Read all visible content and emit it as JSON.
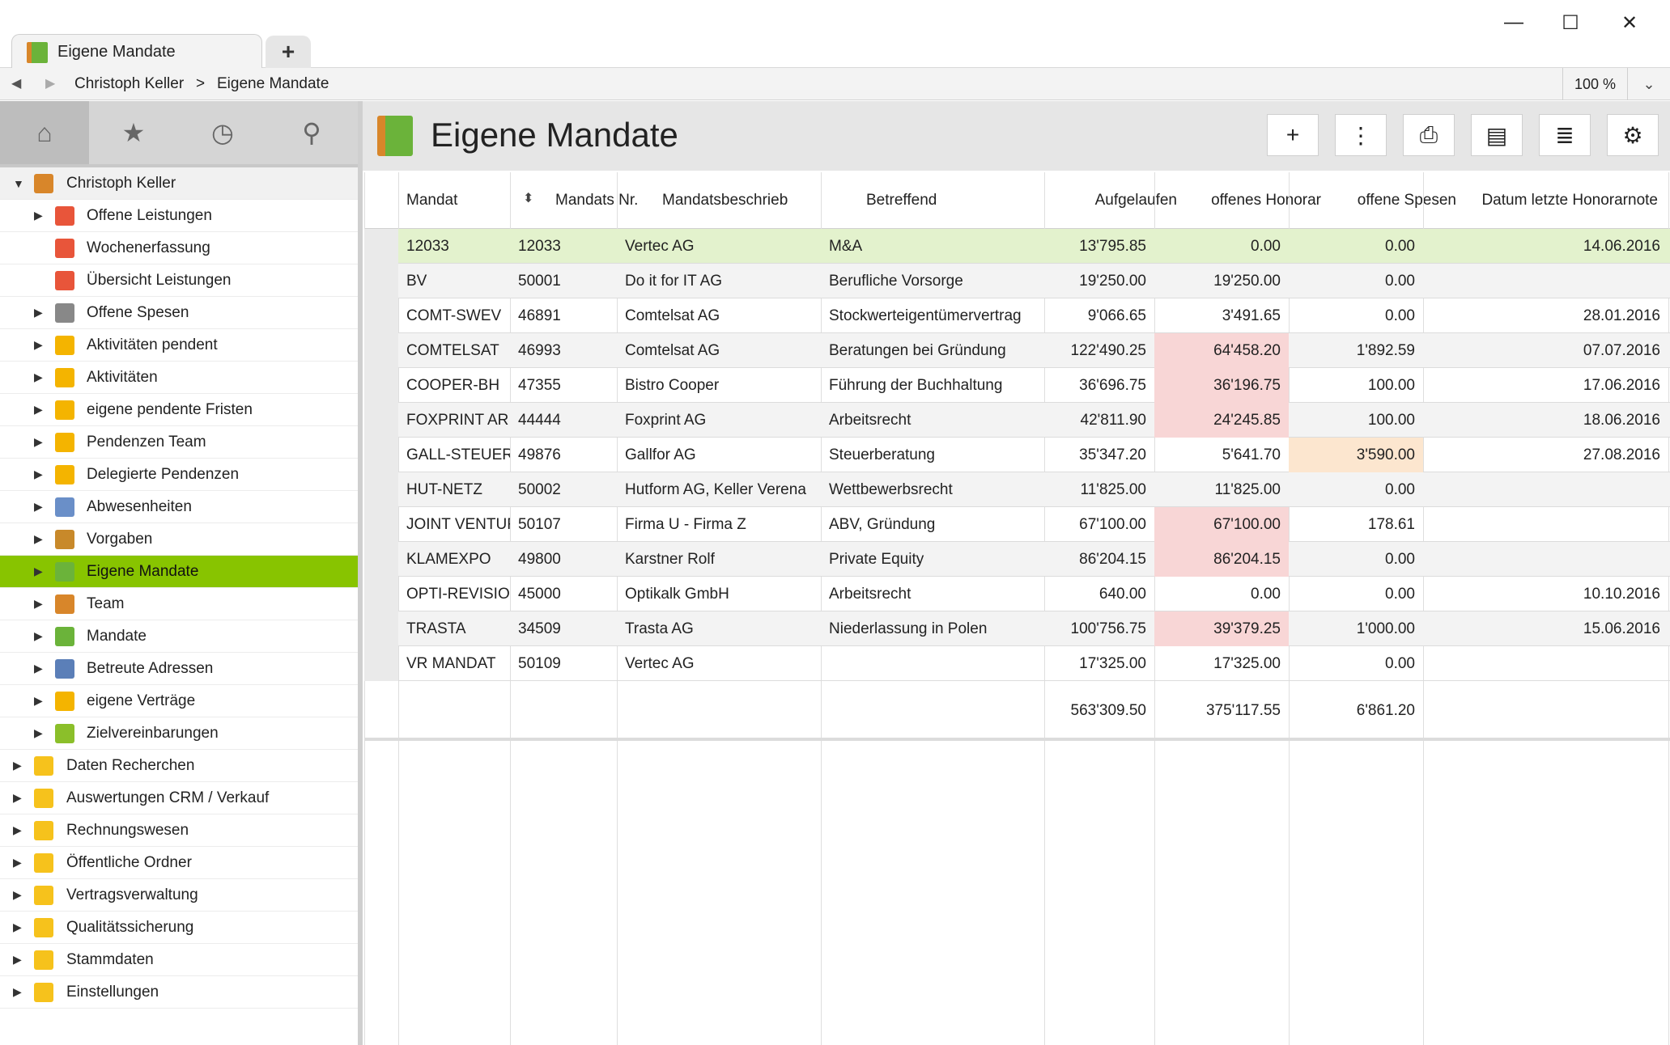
{
  "window": {
    "tab_title": "Eigene Mandate",
    "new_tab": "+",
    "minimize": "—",
    "maximize": "☐",
    "close": "✕"
  },
  "addressbar": {
    "back": "◀",
    "forward": "▶",
    "crumb_user": "Christoph Keller",
    "separator": ">",
    "crumb_page": "Eigene Mandate",
    "zoom": "100 %",
    "zoom_dropdown": "⌄"
  },
  "sidebar": {
    "tabs": [
      {
        "name": "home-icon",
        "glyph": "⌂"
      },
      {
        "name": "star-icon",
        "glyph": "★"
      },
      {
        "name": "clock-icon",
        "glyph": "◷"
      },
      {
        "name": "search-icon",
        "glyph": "⚲"
      }
    ],
    "root": "Christoph Keller",
    "items": [
      {
        "label": "Offene Leistungen",
        "icon": "clock-red-icon",
        "color": "#e8553a",
        "arrow": true
      },
      {
        "label": "Wochenerfassung",
        "icon": "calendar-clock-icon",
        "color": "#e8553a",
        "arrow": false
      },
      {
        "label": "Übersicht Leistungen",
        "icon": "target-icon",
        "color": "#e8553a",
        "arrow": false
      },
      {
        "label": "Offene Spesen",
        "icon": "receipt-icon",
        "color": "#888888",
        "arrow": true
      },
      {
        "label": "Aktivitäten pendent",
        "icon": "star-task-icon",
        "color": "#f4b400",
        "arrow": true
      },
      {
        "label": "Aktivitäten",
        "icon": "star-task-icon",
        "color": "#f4b400",
        "arrow": true
      },
      {
        "label": "eigene pendente Fristen",
        "icon": "star-task-icon",
        "color": "#f4b400",
        "arrow": true
      },
      {
        "label": "Pendenzen Team",
        "icon": "star-task-icon",
        "color": "#f4b400",
        "arrow": true
      },
      {
        "label": "Delegierte Pendenzen",
        "icon": "star-task-icon",
        "color": "#f4b400",
        "arrow": true
      },
      {
        "label": "Abwesenheiten",
        "icon": "person-absence-icon",
        "color": "#6a8fc8",
        "arrow": true
      },
      {
        "label": "Vorgaben",
        "icon": "person-target-icon",
        "color": "#c8892a",
        "arrow": true
      },
      {
        "label": "Eigene Mandate",
        "icon": "binder-icon",
        "color": "#6bb33a",
        "arrow": true,
        "selected": true
      },
      {
        "label": "Team",
        "icon": "person-icon",
        "color": "#d8862a",
        "arrow": true
      },
      {
        "label": "Mandate",
        "icon": "binder-icon",
        "color": "#6bb33a",
        "arrow": true
      },
      {
        "label": "Betreute Adressen",
        "icon": "building-icon",
        "color": "#5b7fb8",
        "arrow": true
      },
      {
        "label": "eigene Verträge",
        "icon": "contract-icon",
        "color": "#f4b400",
        "arrow": true
      },
      {
        "label": "Zielvereinbarungen",
        "icon": "flag-icon",
        "color": "#8bbf2a",
        "arrow": true
      }
    ],
    "folders": [
      {
        "label": "Daten Recherchen",
        "icon": "folder-icon"
      },
      {
        "label": "Auswertungen CRM / Verkauf",
        "icon": "folder-icon"
      },
      {
        "label": "Rechnungswesen",
        "icon": "folder-icon"
      },
      {
        "label": "Öffentliche Ordner",
        "icon": "folder-icon"
      },
      {
        "label": "Vertragsverwaltung",
        "icon": "folder-icon"
      },
      {
        "label": "Qualitätssicherung",
        "icon": "folder-icon"
      },
      {
        "label": "Stammdaten",
        "icon": "folder-icon"
      },
      {
        "label": "Einstellungen",
        "icon": "folder-settings-icon"
      }
    ]
  },
  "main": {
    "title": "Eigene Mandate",
    "toolbar": [
      {
        "name": "add-button",
        "glyph": "+"
      },
      {
        "name": "more-button",
        "glyph": "⋮"
      },
      {
        "name": "print-button",
        "glyph": "⎙"
      },
      {
        "name": "export-button",
        "glyph": "▤"
      },
      {
        "name": "list-settings-button",
        "glyph": "≣"
      },
      {
        "name": "settings-button",
        "glyph": "⚙"
      }
    ],
    "columns": [
      "Mandat",
      "Mandats Nr.",
      "Mandatsbeschrieb",
      "Betreffend",
      "Aufgelaufen",
      "offenes Honorar",
      "offene Spesen",
      "Datum letzte Honorarnote"
    ],
    "sort_glyph": "⬍",
    "rows": [
      {
        "mandat": "12033",
        "nr": "12033",
        "beschrieb": "Vertec AG",
        "betreffend": "M&A",
        "aufgelaufen": "13'795.85",
        "honorar": "0.00",
        "spesen": "0.00",
        "datum": "14.06.2016",
        "honorar_flag": "",
        "spesen_flag": ""
      },
      {
        "mandat": "BV",
        "nr": "50001",
        "beschrieb": "Do it for IT AG",
        "betreffend": "Berufliche Vorsorge",
        "aufgelaufen": "19'250.00",
        "honorar": "19'250.00",
        "spesen": "0.00",
        "datum": "",
        "honorar_flag": "",
        "spesen_flag": ""
      },
      {
        "mandat": "COMT-SWEV",
        "nr": "46891",
        "beschrieb": "Comtelsat AG",
        "betreffend": "Stockwerteigentümervertrag",
        "aufgelaufen": "9'066.65",
        "honorar": "3'491.65",
        "spesen": "0.00",
        "datum": "28.01.2016",
        "honorar_flag": "",
        "spesen_flag": ""
      },
      {
        "mandat": "COMTELSAT",
        "nr": "46993",
        "beschrieb": "Comtelsat AG",
        "betreffend": "Beratungen bei Gründung",
        "aufgelaufen": "122'490.25",
        "honorar": "64'458.20",
        "spesen": "1'892.59",
        "datum": "07.07.2016",
        "honorar_flag": "pink",
        "spesen_flag": ""
      },
      {
        "mandat": "COOPER-BH",
        "nr": "47355",
        "beschrieb": "Bistro Cooper",
        "betreffend": "Führung der Buchhaltung",
        "aufgelaufen": "36'696.75",
        "honorar": "36'196.75",
        "spesen": "100.00",
        "datum": "17.06.2016",
        "honorar_flag": "pink",
        "spesen_flag": ""
      },
      {
        "mandat": "FOXPRINT AR",
        "nr": "44444",
        "beschrieb": "Foxprint AG",
        "betreffend": "Arbeitsrecht",
        "aufgelaufen": "42'811.90",
        "honorar": "24'245.85",
        "spesen": "100.00",
        "datum": "18.06.2016",
        "honorar_flag": "pink",
        "spesen_flag": ""
      },
      {
        "mandat": "GALL-STEUER",
        "nr": "49876",
        "beschrieb": "Gallfor AG",
        "betreffend": "Steuerberatung",
        "aufgelaufen": "35'347.20",
        "honorar": "5'641.70",
        "spesen": "3'590.00",
        "datum": "27.08.2016",
        "honorar_flag": "",
        "spesen_flag": "peach"
      },
      {
        "mandat": "HUT-NETZ",
        "nr": "50002",
        "beschrieb": "Hutform AG, Keller Verena",
        "betreffend": "Wettbewerbsrecht",
        "aufgelaufen": "11'825.00",
        "honorar": "11'825.00",
        "spesen": "0.00",
        "datum": "",
        "honorar_flag": "",
        "spesen_flag": ""
      },
      {
        "mandat": "JOINT VENTURE",
        "nr": "50107",
        "beschrieb": "Firma U - Firma Z",
        "betreffend": "ABV, Gründung",
        "aufgelaufen": "67'100.00",
        "honorar": "67'100.00",
        "spesen": "178.61",
        "datum": "",
        "honorar_flag": "pink",
        "spesen_flag": ""
      },
      {
        "mandat": "KLAMEXPO",
        "nr": "49800",
        "beschrieb": "Karstner Rolf",
        "betreffend": "Private Equity",
        "aufgelaufen": "86'204.15",
        "honorar": "86'204.15",
        "spesen": "0.00",
        "datum": "",
        "honorar_flag": "pink",
        "spesen_flag": ""
      },
      {
        "mandat": "OPTI-REVISION",
        "nr": "45000",
        "beschrieb": "Optikalk GmbH",
        "betreffend": "Arbeitsrecht",
        "aufgelaufen": "640.00",
        "honorar": "0.00",
        "spesen": "0.00",
        "datum": "10.10.2016",
        "honorar_flag": "",
        "spesen_flag": ""
      },
      {
        "mandat": "TRASTA",
        "nr": "34509",
        "beschrieb": "Trasta AG",
        "betreffend": "Niederlassung in Polen",
        "aufgelaufen": "100'756.75",
        "honorar": "39'379.25",
        "spesen": "1'000.00",
        "datum": "15.06.2016",
        "honorar_flag": "pink",
        "spesen_flag": ""
      },
      {
        "mandat": "VR MANDAT",
        "nr": "50109",
        "beschrieb": "Vertec AG",
        "betreffend": "",
        "aufgelaufen": "17'325.00",
        "honorar": "17'325.00",
        "spesen": "0.00",
        "datum": "",
        "honorar_flag": "",
        "spesen_flag": ""
      }
    ],
    "totals": {
      "aufgelaufen": "563'309.50",
      "honorar": "375'117.55",
      "spesen": "6'861.20"
    },
    "colors": {
      "highlight_row": "#e3f2cd",
      "overdue": "#f8d6d6",
      "warning": "#fce6cf",
      "accent": "#88c400"
    }
  }
}
